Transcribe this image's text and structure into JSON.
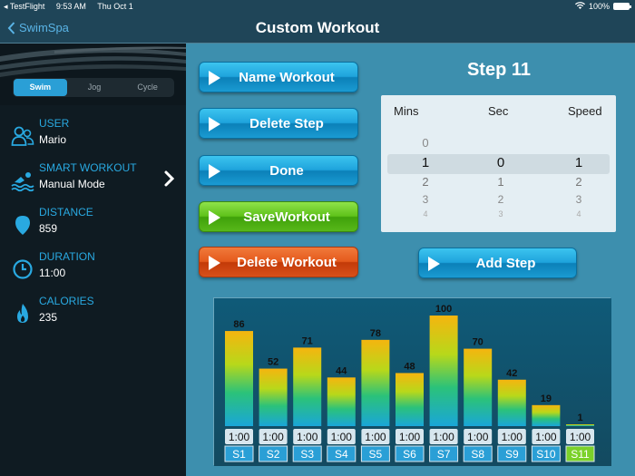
{
  "status_bar": {
    "back_app": "◂ TestFlight",
    "time": "9:53 AM",
    "date": "Thu Oct 1",
    "battery": "100%"
  },
  "nav": {
    "back_label": "SwimSpa",
    "title": "Custom Workout"
  },
  "modes": {
    "items": [
      "Swim",
      "Jog",
      "Cycle"
    ],
    "selected": "Swim"
  },
  "sidebar": {
    "user": {
      "label": "USER",
      "value": "Mario",
      "icon": "users-icon"
    },
    "smart_workout": {
      "label": "SMART WORKOUT",
      "value": "Manual Mode",
      "icon": "swimmer-icon"
    },
    "distance": {
      "label": "DISTANCE",
      "value": "859",
      "icon": "location-pin-icon"
    },
    "duration": {
      "label": "DURATION",
      "value": "11:00",
      "icon": "clock-icon"
    },
    "calories": {
      "label": "CALORIES",
      "value": "235",
      "icon": "flame-icon"
    }
  },
  "buttons": {
    "name_workout": "Name Workout",
    "delete_step": "Delete Step",
    "done": "Done",
    "save_workout": "SaveWorkout",
    "delete_workout": "Delete Workout",
    "add_step": "Add Step"
  },
  "step": {
    "title": "Step 11"
  },
  "picker": {
    "headers": {
      "mins": "Mins",
      "sec": "Sec",
      "speed": "Speed"
    },
    "mins": [
      "0",
      "1",
      "2",
      "3",
      "4"
    ],
    "sec": [
      "",
      "0",
      "1",
      "2",
      "3"
    ],
    "speed": [
      "",
      "1",
      "2",
      "3",
      "4"
    ],
    "selected": {
      "mins": "1",
      "sec": "0",
      "speed": "1"
    }
  },
  "chart_data": {
    "type": "bar",
    "categories": [
      "S1",
      "S2",
      "S3",
      "S4",
      "S5",
      "S6",
      "S7",
      "S8",
      "S9",
      "S10",
      "S11"
    ],
    "values": [
      86,
      52,
      71,
      44,
      78,
      48,
      100,
      70,
      42,
      19,
      1
    ],
    "durations": [
      "1:00",
      "1:00",
      "1:00",
      "1:00",
      "1:00",
      "1:00",
      "1:00",
      "1:00",
      "1:00",
      "1:00",
      "1:00"
    ],
    "selected": "S11",
    "ylim": [
      0,
      100
    ]
  },
  "colors": {
    "accent": "#29a9e1",
    "selected_tab": "#7bd12a",
    "tab": "#2a9fd6"
  }
}
